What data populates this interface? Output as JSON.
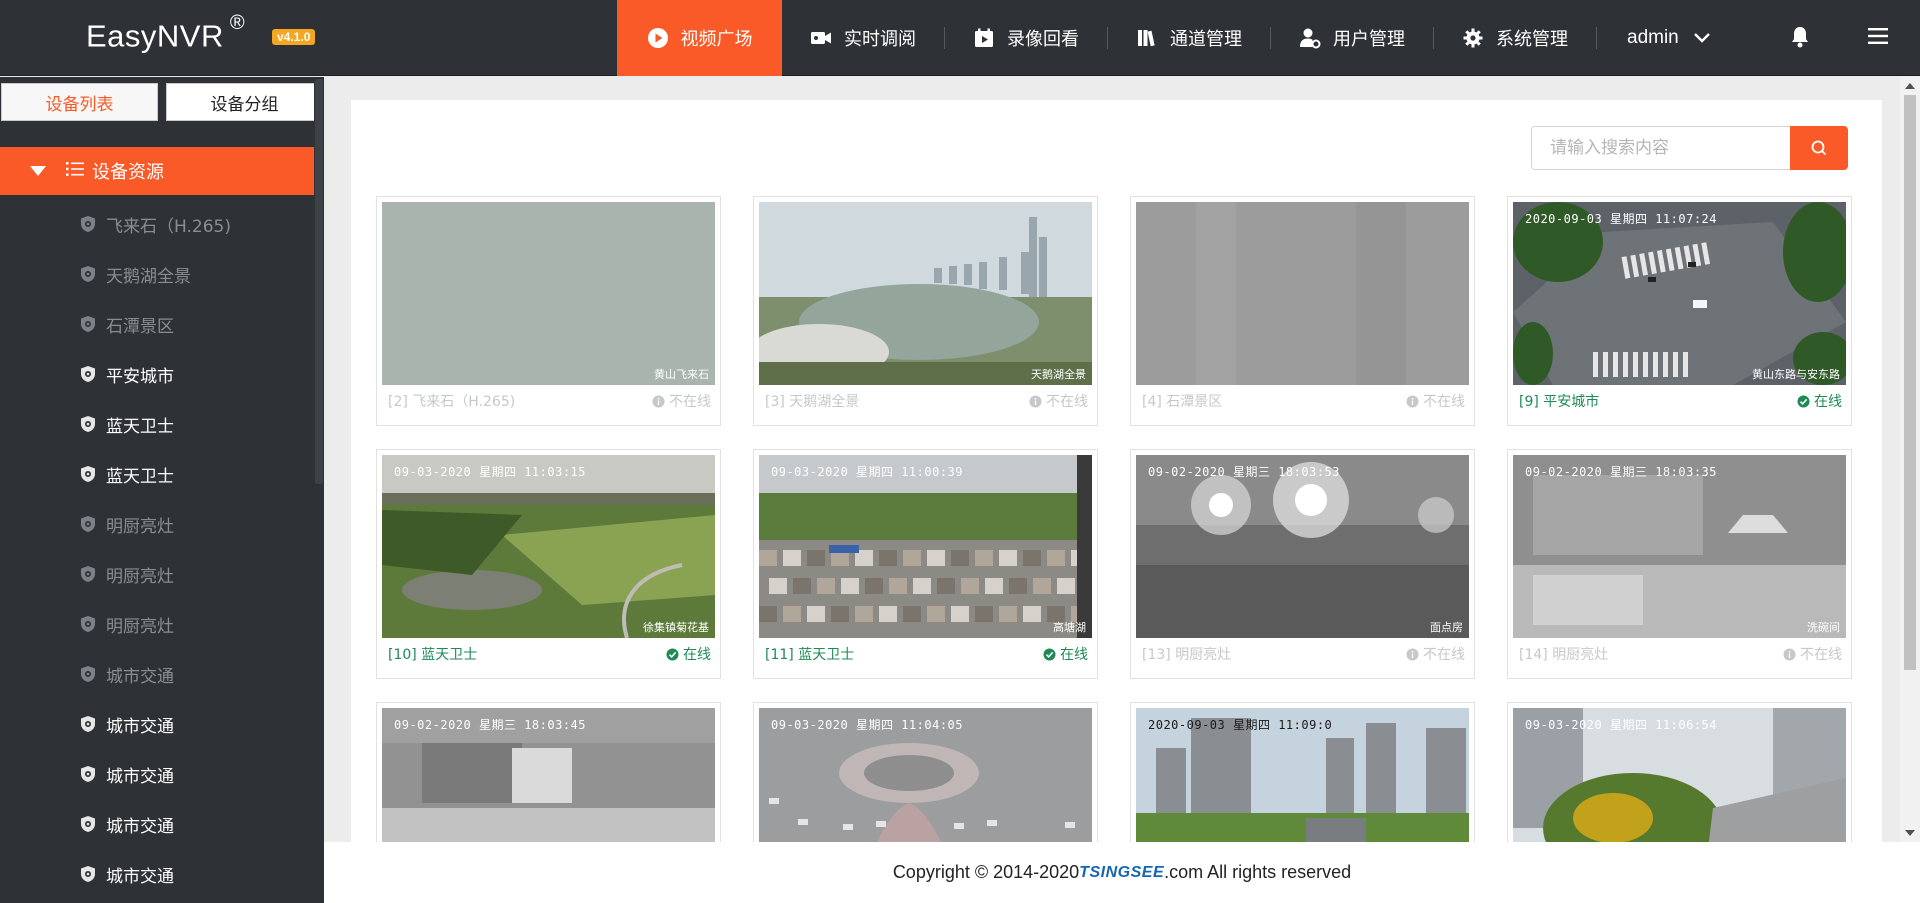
{
  "header": {
    "brand": "EasyNVR",
    "brand_mark": "®",
    "version": "v4.1.0",
    "nav": [
      {
        "label": "视频广场",
        "icon": "play-circle-icon",
        "active": true
      },
      {
        "label": "实时调阅",
        "icon": "video-camera-icon",
        "active": false
      },
      {
        "label": "录像回看",
        "icon": "calendar-play-icon",
        "active": false
      },
      {
        "label": "通道管理",
        "icon": "books-icon",
        "active": false
      },
      {
        "label": "用户管理",
        "icon": "user-settings-icon",
        "active": false
      },
      {
        "label": "系统管理",
        "icon": "gear-icon",
        "active": false
      }
    ],
    "user": "admin"
  },
  "sidebar": {
    "tabs": [
      "设备列表",
      "设备分组"
    ],
    "root": "设备资源",
    "devices": [
      {
        "label": "飞来石（H.265)",
        "online": false
      },
      {
        "label": "天鹅湖全景",
        "online": false
      },
      {
        "label": "石潭景区",
        "online": false
      },
      {
        "label": "平安城市",
        "online": true
      },
      {
        "label": "蓝天卫士",
        "online": true
      },
      {
        "label": "蓝天卫士",
        "online": true
      },
      {
        "label": "明厨亮灶",
        "online": false
      },
      {
        "label": "明厨亮灶",
        "online": false
      },
      {
        "label": "明厨亮灶",
        "online": false
      },
      {
        "label": "城市交通",
        "online": false
      },
      {
        "label": "城市交通",
        "online": true
      },
      {
        "label": "城市交通",
        "online": true
      },
      {
        "label": "城市交通",
        "online": true
      },
      {
        "label": "城市交通",
        "online": true
      }
    ]
  },
  "search": {
    "placeholder": "请输入搜索内容"
  },
  "cards": [
    {
      "title": "[2] 飞来石（H.265)",
      "status": "不在线",
      "online": false,
      "osd": "",
      "osd_br": "黄山飞来石",
      "scene": "fog"
    },
    {
      "title": "[3] 天鹅湖全景",
      "status": "不在线",
      "online": false,
      "osd": "",
      "osd_br": "天鹅湖全景",
      "scene": "lake"
    },
    {
      "title": "[4] 石潭景区",
      "status": "不在线",
      "online": false,
      "osd": "",
      "osd_br": "",
      "scene": "grey"
    },
    {
      "title": "[9] 平安城市",
      "status": "在线",
      "online": true,
      "osd": "2020-09-03 星期四 11:07:24",
      "osd_br": "黄山东路与安东路",
      "scene": "intersection"
    },
    {
      "title": "[10] 蓝天卫士",
      "status": "在线",
      "online": true,
      "osd": "09-03-2020 星期四 11:03:15",
      "osd_br": "徐集镇菊花基",
      "scene": "fields"
    },
    {
      "title": "[11] 蓝天卫士",
      "status": "在线",
      "online": true,
      "osd": "09-03-2020 星期四 11:00:39",
      "osd_br": "高塘湖",
      "scene": "village"
    },
    {
      "title": "[13] 明厨亮灶",
      "status": "不在线",
      "online": false,
      "osd": "09-02-2020 星期三 18:03:53",
      "osd_br": "面点房",
      "scene": "kitchen-dark"
    },
    {
      "title": "[14] 明厨亮灶",
      "status": "不在线",
      "online": false,
      "osd": "09-02-2020 星期三 18:03:35",
      "osd_br": "洗碗间",
      "scene": "kitchen"
    },
    {
      "title": "",
      "status": "",
      "online": false,
      "osd": "09-02-2020 星期三 18:03:45",
      "osd_br": "",
      "scene": "kitchen2"
    },
    {
      "title": "",
      "status": "",
      "online": true,
      "osd": "09-03-2020 星期四 11:04:05",
      "osd_br": "",
      "scene": "roundabout"
    },
    {
      "title": "",
      "status": "",
      "online": true,
      "osd": "2020-09-03 星期四 11:09:0",
      "osd_br": "",
      "scene": "city"
    },
    {
      "title": "",
      "status": "",
      "online": true,
      "osd": "09-03-2020 星期四 11:06:54",
      "osd_br": "",
      "scene": "street"
    }
  ],
  "footer": {
    "prefix": "Copyright © 2014-2020 ",
    "logo": "TSINGSEE",
    "suffix": ".com All rights reserved"
  },
  "colors": {
    "accent": "#fa5a27",
    "online": "#1e8a55",
    "offline": "#c5c8cc",
    "header": "#2e3236"
  }
}
